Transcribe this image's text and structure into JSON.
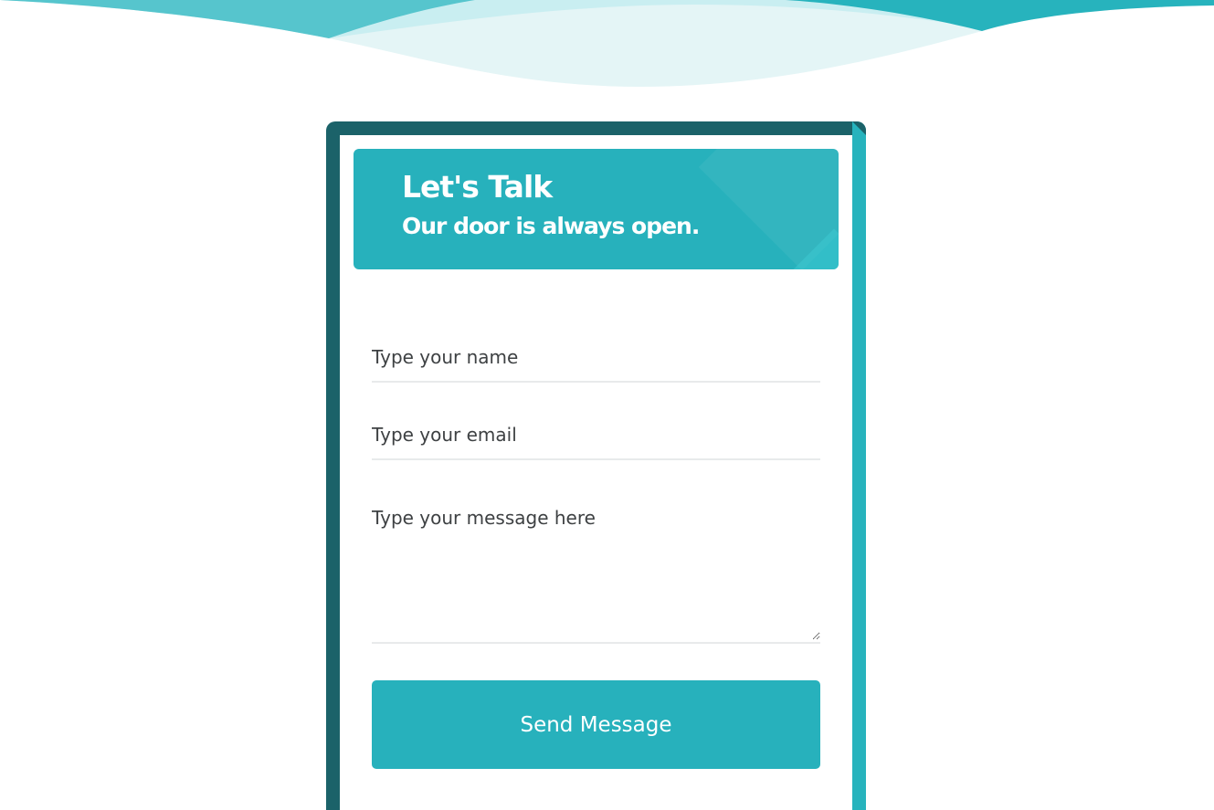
{
  "header": {
    "title": "Let's Talk",
    "subtitle": "Our door is always open."
  },
  "form": {
    "name_placeholder": "Type your name",
    "email_placeholder": "Type your email",
    "message_placeholder": "Type your message here",
    "submit_label": "Send Message"
  },
  "colors": {
    "accent": "#27b1bc",
    "frame_dark": "#1b6269",
    "wave_light": "#dff3f5",
    "text": "#3e4143"
  }
}
